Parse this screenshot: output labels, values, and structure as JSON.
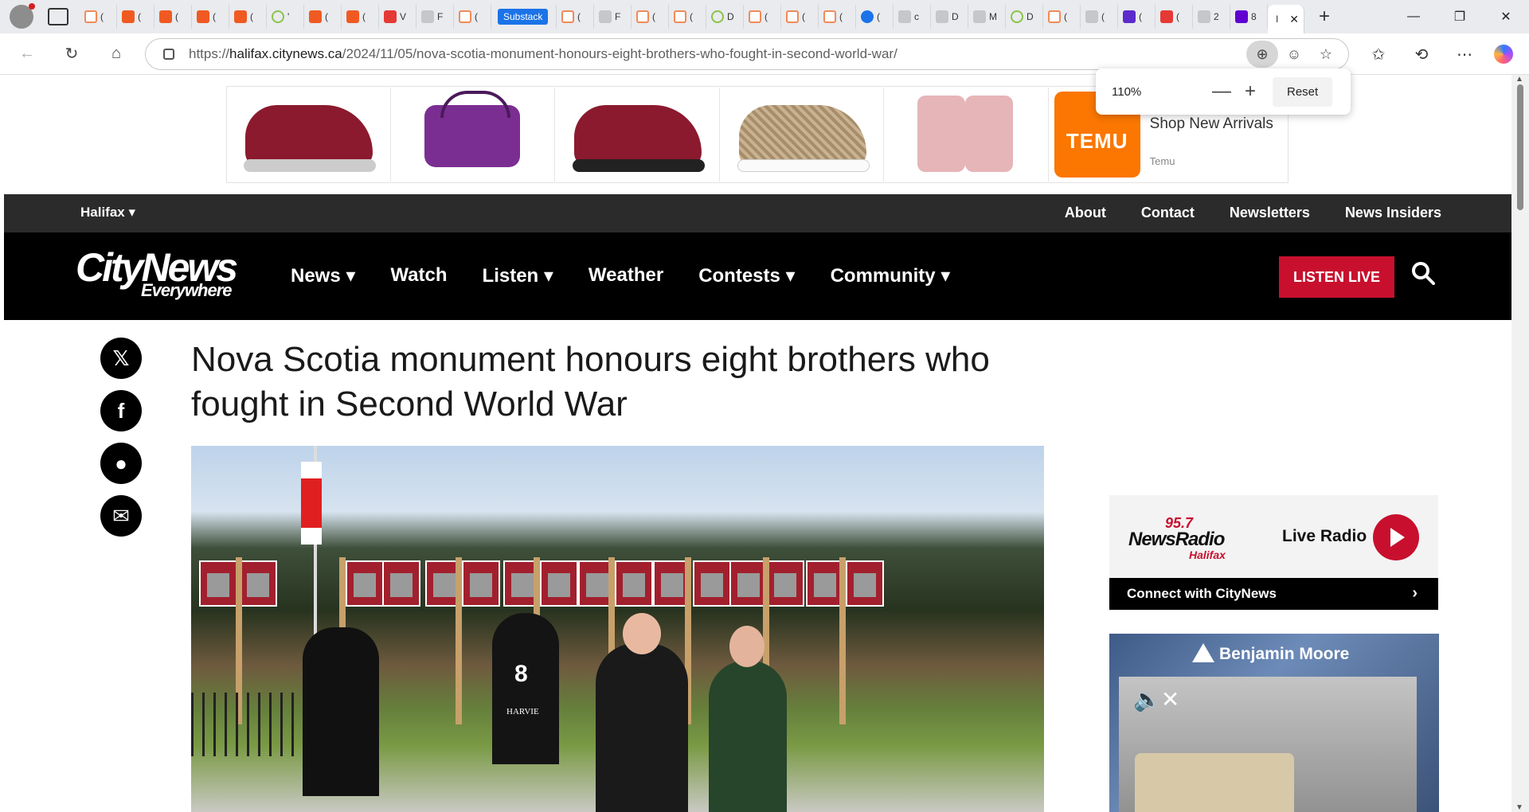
{
  "browser": {
    "tabs": [
      {
        "icon": "orange-bookmark-icon",
        "title": "(",
        "style": "orange-o"
      },
      {
        "icon": "orange-bookmark-icon",
        "title": "(",
        "style": "orange"
      },
      {
        "icon": "orange-bookmark-icon",
        "title": "(",
        "style": "orange"
      },
      {
        "icon": "orange-bookmark-icon",
        "title": "(",
        "style": "orange"
      },
      {
        "icon": "orange-bookmark-icon",
        "title": "(",
        "style": "orange"
      },
      {
        "icon": "play-icon",
        "title": "'",
        "style": "green"
      },
      {
        "icon": "orange-bookmark-icon",
        "title": "(",
        "style": "orange"
      },
      {
        "icon": "orange-bookmark-icon",
        "title": "(",
        "style": "orange"
      },
      {
        "icon": "video-icon",
        "title": "V",
        "style": "red"
      },
      {
        "icon": "gp-icon",
        "title": "F",
        "style": "gray"
      },
      {
        "icon": "orange-bookmark-icon",
        "title": "(",
        "style": "orange-o"
      },
      {
        "icon": "orange-bookmark-icon",
        "title": "(",
        "style": "orange-o"
      },
      {
        "icon": "page-icon",
        "title": "F",
        "style": "gray"
      },
      {
        "icon": "orange-bookmark-icon",
        "title": "(",
        "style": "orange-o"
      },
      {
        "icon": "orange-bookmark-icon",
        "title": "(",
        "style": "orange-o"
      },
      {
        "icon": "play-icon",
        "title": "D",
        "style": "green"
      },
      {
        "icon": "orange-bookmark-icon",
        "title": "(",
        "style": "orange-o"
      },
      {
        "icon": "orange-bookmark-icon",
        "title": "(",
        "style": "orange-o"
      },
      {
        "icon": "orange-bookmark-icon",
        "title": "(",
        "style": "orange-o"
      },
      {
        "icon": "page-icon",
        "title": "(",
        "style": "blue"
      },
      {
        "icon": "search-icon",
        "title": "c",
        "style": "gray"
      },
      {
        "icon": "page-icon",
        "title": "D",
        "style": "gray"
      },
      {
        "icon": "page-icon",
        "title": "M",
        "style": "gray"
      },
      {
        "icon": "play-icon",
        "title": "D",
        "style": "green"
      },
      {
        "icon": "page-icon",
        "title": "(",
        "style": "orange-o"
      },
      {
        "icon": "page-icon",
        "title": "(",
        "style": "gray"
      },
      {
        "icon": "mail-icon",
        "title": "(",
        "style": "mail"
      },
      {
        "icon": "youtube-icon",
        "title": "(",
        "style": "red"
      },
      {
        "icon": "page-icon",
        "title": "2",
        "style": "gray"
      },
      {
        "icon": "yahoo-icon",
        "title": "8",
        "style": "yahoo"
      }
    ],
    "badge_tab_label": "Substack",
    "active_tab_title": "I",
    "url_prefix": "https://",
    "url_host": "halifax.citynews.ca",
    "url_path": "/2024/11/05/nova-scotia-monument-honours-eight-brothers-who-fought-in-second-world-war/",
    "zoom": {
      "percent": "110%",
      "minus": "—",
      "plus": "+",
      "reset_label": "Reset"
    },
    "notification_count": "1"
  },
  "ad_banner": {
    "cta": "Shop New Arrivals",
    "advertiser": "Temu",
    "logo_text": "TEMU"
  },
  "top_nav": {
    "location": "Halifax ▾",
    "links": [
      "About",
      "Contact",
      "Newsletters",
      "News Insiders"
    ]
  },
  "main_nav": {
    "logo_line1": "CityNews",
    "logo_line2": "Everywhere",
    "items": [
      "News ▾",
      "Watch",
      "Listen ▾",
      "Weather",
      "Contests ▾",
      "Community ▾"
    ],
    "listen_live": "LISTEN LIVE"
  },
  "share": {
    "x": "𝕏",
    "facebook": "f",
    "reddit": "●",
    "email": "✉"
  },
  "article": {
    "headline": "Nova Scotia monument honours eight brothers who fought in Second World War",
    "monument_number": "8",
    "monument_name": "HARVIE"
  },
  "sidebar": {
    "radio_logo_num": "95.7",
    "radio_logo_name": "NewsRadio",
    "radio_logo_city": "Halifax",
    "live_radio": "Live Radio",
    "connect": "Connect with CityNews",
    "ad_brand": "Benjamin Moore"
  }
}
